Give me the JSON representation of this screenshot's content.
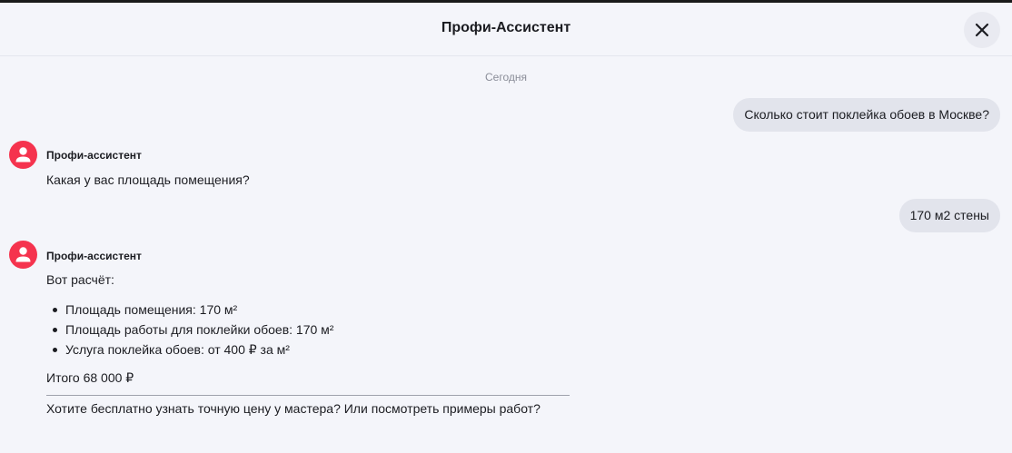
{
  "header": {
    "title": "Профи-Ассистент"
  },
  "chat": {
    "date_separator": "Сегодня",
    "messages": [
      {
        "role": "user",
        "text": "Сколько стоит поклейка обоев в Москве?"
      },
      {
        "role": "assistant",
        "sender": "Профи-ассистент",
        "text": "Какая у вас площадь помещения?"
      },
      {
        "role": "user",
        "text": "170 м2 стены"
      },
      {
        "role": "assistant",
        "sender": "Профи-ассистент",
        "intro": "Вот расчёт:",
        "bullets": [
          "Площадь помещения: 170 м²",
          "Площадь работы для поклейки обоев: 170 м²",
          "Услуга поклейка обоев: от 400 ₽ за м²"
        ],
        "total": "Итого 68 000 ₽",
        "question": "Хотите бесплатно узнать точную цену у мастера? Или посмотреть примеры работ?"
      }
    ]
  },
  "colors": {
    "background": "#F4F5FA",
    "user_bubble": "#E2E4EC",
    "avatar_accent": "#F5334E",
    "text": "#1B1C21",
    "muted_text": "#8B8E99"
  },
  "icons": {
    "close": "close-icon",
    "avatar": "user-avatar-icon"
  }
}
